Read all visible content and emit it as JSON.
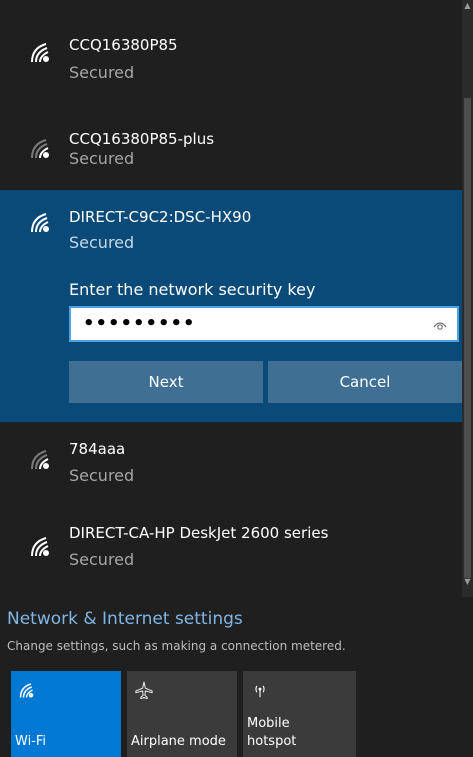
{
  "networks": [
    {
      "ssid": "CCQ16380P85",
      "status": "Secured"
    },
    {
      "ssid": "CCQ16380P85-plus",
      "status": "Secured"
    },
    {
      "ssid": "DIRECT-C9C2:DSC-HX90",
      "status": "Secured",
      "prompt": "Enter the network security key",
      "password_mask": "•••••••••",
      "next_label": "Next",
      "cancel_label": "Cancel"
    },
    {
      "ssid": "784aaa",
      "status": "Secured"
    },
    {
      "ssid": "DIRECT-CA-HP DeskJet 2600 series",
      "status": "Secured"
    }
  ],
  "settings": {
    "title": "Network & Internet settings",
    "subtitle": "Change settings, such as making a connection metered."
  },
  "tiles": [
    {
      "label": "Wi-Fi",
      "icon": "wifi-icon"
    },
    {
      "label": "Airplane mode",
      "icon": "airplane-icon"
    },
    {
      "label_line1": "Mobile",
      "label_line2": "hotspot",
      "icon": "hotspot-icon"
    }
  ],
  "colors": {
    "background": "#1f1f1f",
    "selected_network": "#0a4a78",
    "accent": "#0078d4",
    "link": "#7fb6e6"
  }
}
